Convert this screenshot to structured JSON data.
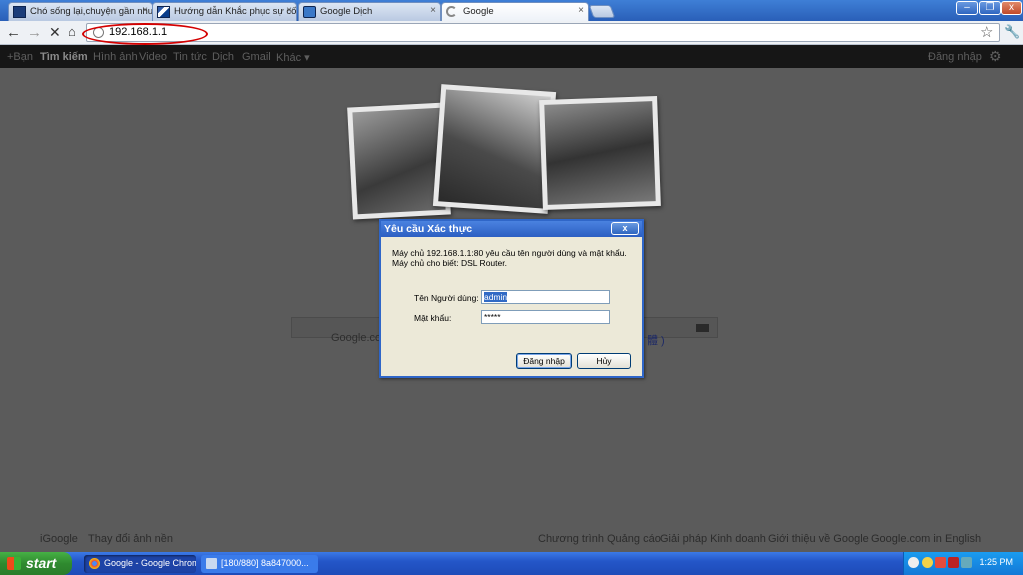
{
  "browser": {
    "tabs": [
      {
        "label": "Chó sống lại,chuyện gần như k",
        "icon": "blog-favicon-icon"
      },
      {
        "label": "Hướng dẫn Khắc phục sự cố m",
        "icon": "site-favicon-icon"
      },
      {
        "label": "Google Dịch",
        "icon": "translate-icon"
      },
      {
        "label": "Google",
        "icon": "loading-icon",
        "active": true
      }
    ],
    "address": "192.168.1.1",
    "annotation_color": "#d40000"
  },
  "google_bar": {
    "items": [
      "+Bạn",
      "Tìm kiếm",
      "Hình ảnh",
      "Video",
      "Tin tức",
      "Dịch",
      "Gmail",
      "Khác ▾"
    ],
    "signin": "Đăng nhập"
  },
  "page": {
    "offered_prefix": "Google.com",
    "offered_suffix": "體 )",
    "footer_left": [
      "iGoogle",
      "Thay đổi ảnh nền"
    ],
    "footer_right": [
      "Chương trình Quảng cáo",
      "Giải pháp Kinh doanh",
      "Giới thiệu về Google",
      "Google.com in English"
    ]
  },
  "dialog": {
    "title": "Yêu cầu Xác thực",
    "line1": "Máy chủ 192.168.1.1:80 yêu cầu tên người dùng và mật khẩu.",
    "line2": "Máy chủ cho biết: DSL Router.",
    "username_label": "Tên Người dùng:",
    "username_value": "admin",
    "password_label": "Mật khẩu:",
    "password_mask": "*****",
    "login_button": "Đăng nhập",
    "cancel_button": "Hủy",
    "close_glyph": "x"
  },
  "taskbar": {
    "start_label": "start",
    "tasks": [
      "Google - Google Chrome",
      "[180/880] 8a847000..."
    ],
    "clock": "1:25 PM"
  }
}
